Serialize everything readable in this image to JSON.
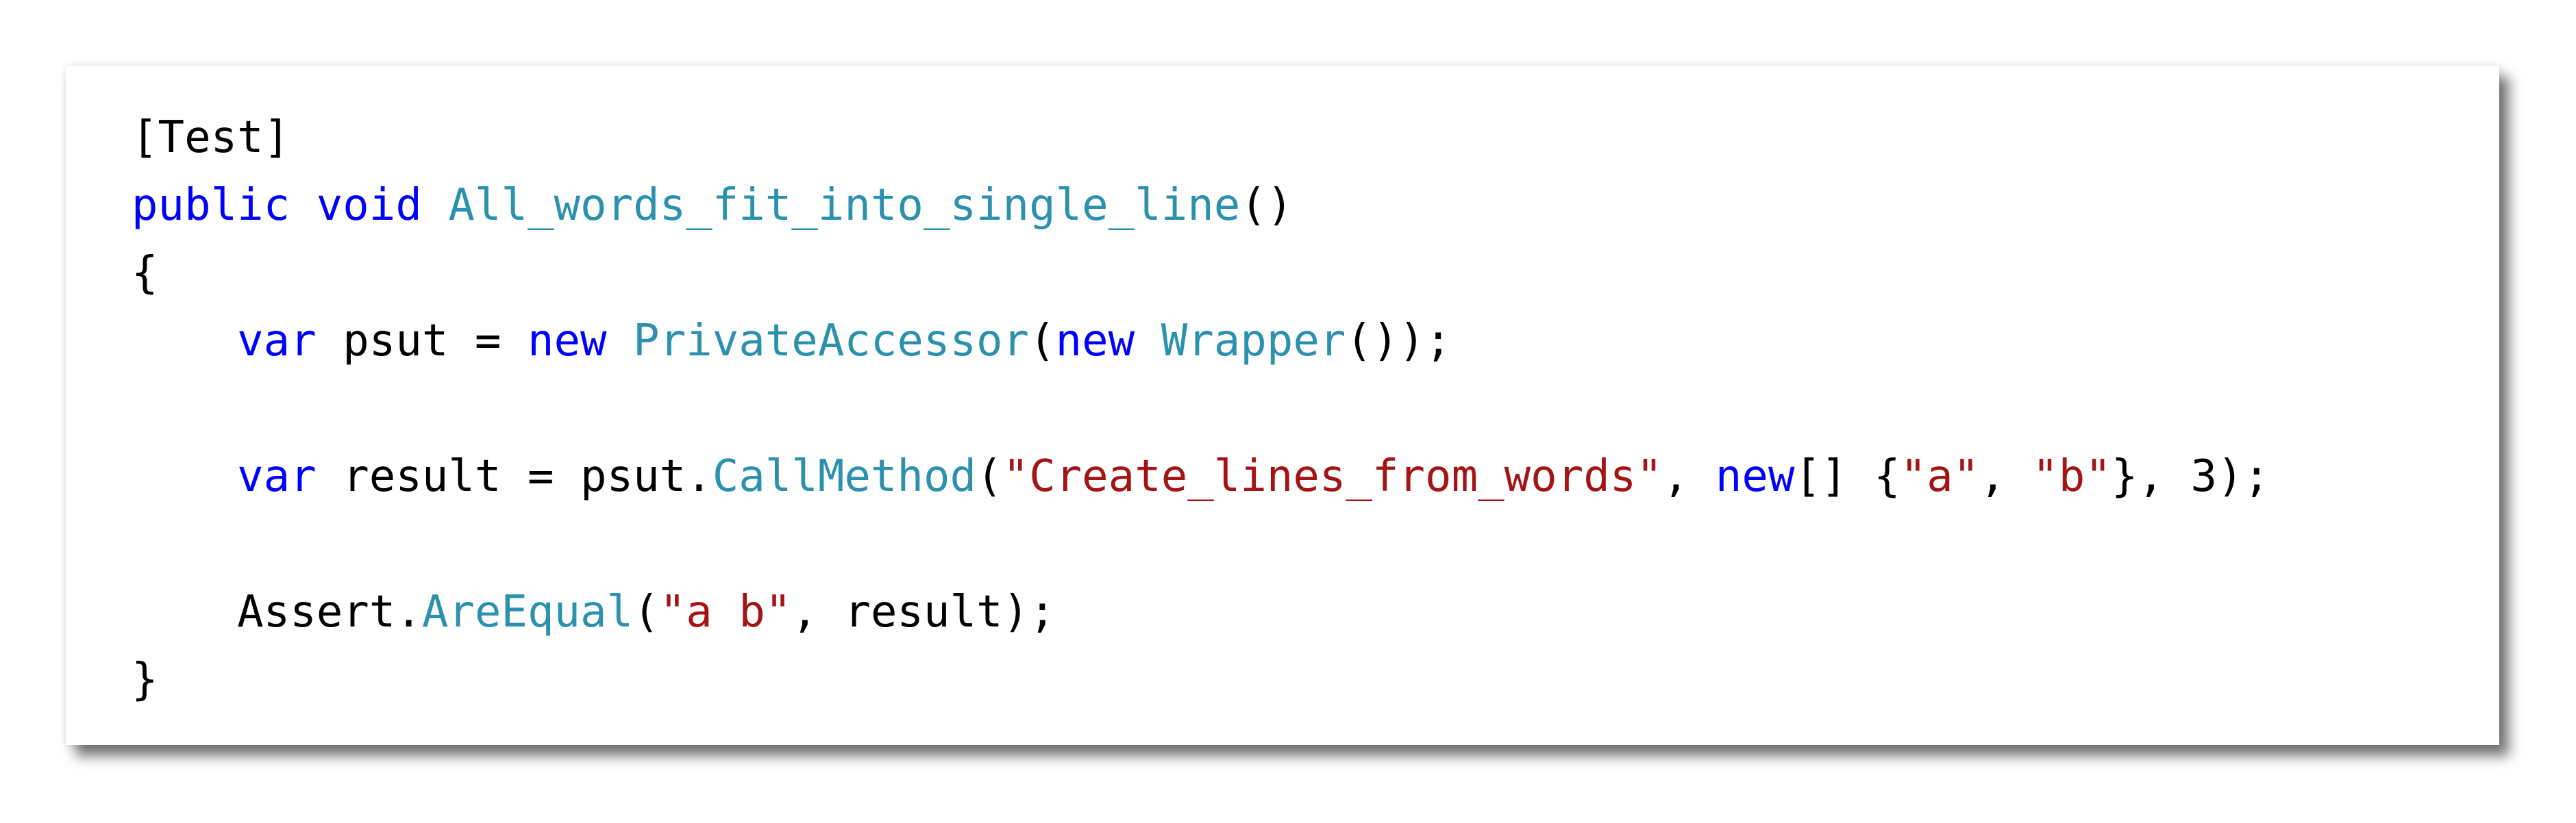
{
  "colors": {
    "keyword": "#0000ff",
    "type": "#2b91af",
    "string": "#a31515",
    "plain": "#000000",
    "background": "#ffffff"
  },
  "code": {
    "line1": {
      "attr": "[Test]"
    },
    "line2": {
      "kw_public": "public",
      "sp1": " ",
      "kw_void": "void",
      "sp2": " ",
      "method": "All_words_fit_into_single_line",
      "parens": "()"
    },
    "line3": {
      "brace_open": "{"
    },
    "line4": {
      "indent": "    ",
      "kw_var": "var",
      "text1": " psut = ",
      "kw_new1": "new",
      "sp": " ",
      "type_private": "PrivateAccessor",
      "paren_open": "(",
      "kw_new2": "new",
      "sp2": " ",
      "type_wrapper": "Wrapper",
      "tail": "());"
    },
    "line5": {
      "blank": ""
    },
    "line6": {
      "indent": "    ",
      "kw_var": "var",
      "text1": " result = psut.",
      "method_call": "CallMethod",
      "paren_open": "(",
      "str_method": "\"Create_lines_from_words\"",
      "comma1": ", ",
      "kw_new": "new",
      "brackets": "[] {",
      "str_a": "\"a\"",
      "comma2": ", ",
      "str_b": "\"b\"",
      "tail": "}, 3);"
    },
    "line7": {
      "blank": ""
    },
    "line8": {
      "indent": "    ",
      "assert": "Assert.",
      "method": "AreEqual",
      "paren_open": "(",
      "str_ab": "\"a b\"",
      "tail": ", result);"
    },
    "line9": {
      "brace_close": "}"
    }
  }
}
